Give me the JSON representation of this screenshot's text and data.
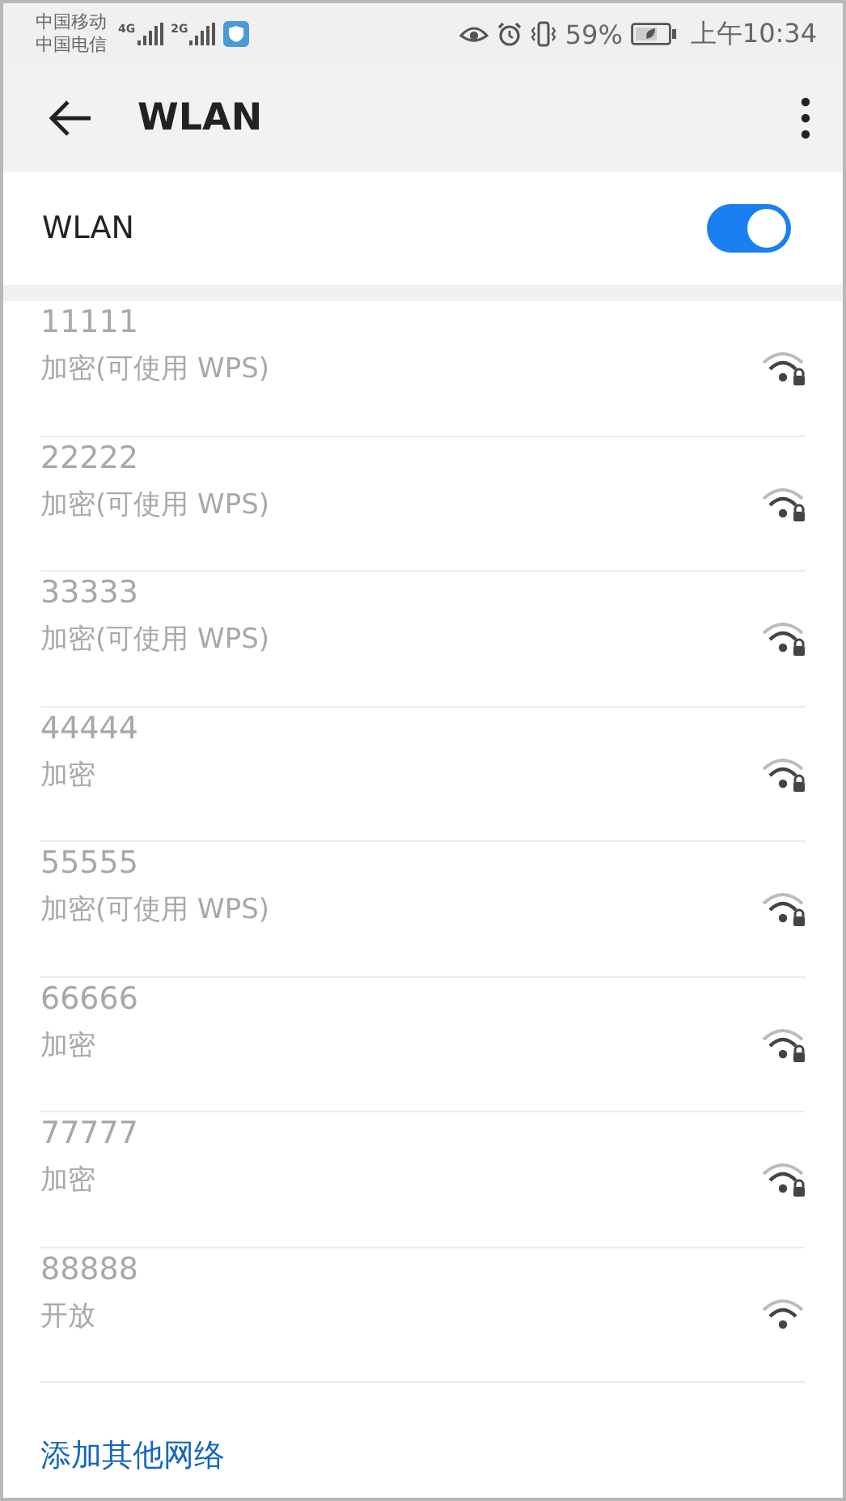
{
  "status_bar": {
    "carriers": [
      "中国移动",
      "中国电信"
    ],
    "signals": [
      {
        "network": "4G"
      },
      {
        "network": "2G"
      }
    ],
    "battery": "59%",
    "time": "上午10:34"
  },
  "header": {
    "title": "WLAN"
  },
  "wlan": {
    "label": "WLAN",
    "on": true
  },
  "networks": [
    {
      "name": "11111",
      "security": "加密(可使用 WPS)",
      "locked": true
    },
    {
      "name": "22222",
      "security": "加密(可使用 WPS)",
      "locked": true
    },
    {
      "name": "33333",
      "security": "加密(可使用 WPS)",
      "locked": true
    },
    {
      "name": "44444",
      "security": "加密",
      "locked": true
    },
    {
      "name": "55555",
      "security": "加密(可使用 WPS)",
      "locked": true
    },
    {
      "name": "66666",
      "security": "加密",
      "locked": true
    },
    {
      "name": "77777",
      "security": "加密",
      "locked": true
    },
    {
      "name": "88888",
      "security": "开放",
      "locked": false
    }
  ],
  "add_network": "添加其他网络"
}
